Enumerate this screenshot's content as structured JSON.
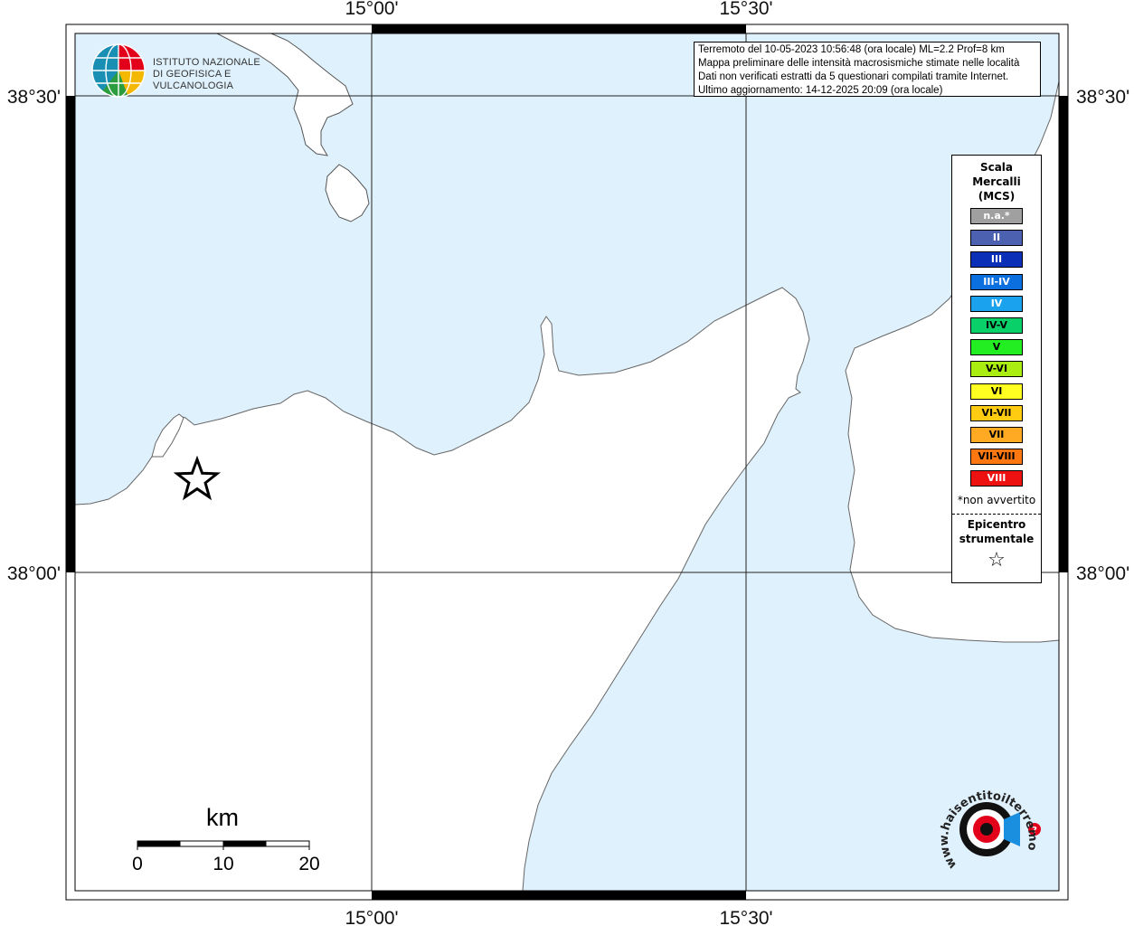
{
  "map": {
    "lon_labels": [
      "15°00'",
      "15°30'"
    ],
    "lat_labels": [
      "38°30'",
      "38°00'"
    ],
    "colors": {
      "sea": "#dff1fc",
      "land": "#ffffff",
      "coast": "#555555",
      "grid": "#222222"
    }
  },
  "info": {
    "line1": "Terremoto del 10-05-2023 10:56:48 (ora locale) ML=2.2 Prof=8 km",
    "line2": "Mappa preliminare delle intensità macrosismiche stimate nelle località",
    "line3": "Dati non verificati estratti da 5 questionari compilati tramite Internet.",
    "line4": "Ultimo aggiornamento: 14-12-2025 20:09 (ora locale)"
  },
  "logo": {
    "line1": "ISTITUTO NAZIONALE",
    "line2": "DI GEOFISICA E VULCANOLOGIA"
  },
  "legend": {
    "title1": "Scala",
    "title2": "Mercalli",
    "title3": "(MCS)",
    "items": [
      {
        "label": "n.a.*",
        "color": "#a0a0a0",
        "text": "#ffffff"
      },
      {
        "label": "II",
        "color": "#4c62b0",
        "text": "#ffffff"
      },
      {
        "label": "III",
        "color": "#0c2fb8",
        "text": "#ffffff"
      },
      {
        "label": "III-IV",
        "color": "#0b6fe0",
        "text": "#ffffff"
      },
      {
        "label": "IV",
        "color": "#1aa2ee",
        "text": "#ffffff"
      },
      {
        "label": "IV-V",
        "color": "#0ad06a",
        "text": "#000000"
      },
      {
        "label": "V",
        "color": "#22ee22",
        "text": "#000000"
      },
      {
        "label": "V-VI",
        "color": "#aaee11",
        "text": "#000000"
      },
      {
        "label": "VI",
        "color": "#ffff22",
        "text": "#000000"
      },
      {
        "label": "VI-VII",
        "color": "#ffcc11",
        "text": "#000000"
      },
      {
        "label": "VII",
        "color": "#ffaa22",
        "text": "#000000"
      },
      {
        "label": "VII-VIII",
        "color": "#ff7711",
        "text": "#000000"
      },
      {
        "label": "VIII",
        "color": "#ee1111",
        "text": "#ffffff"
      }
    ],
    "note": "*non avvertito",
    "epicenter1": "Epicentro",
    "epicenter2": "strumentale",
    "epicenter_symbol": "☆"
  },
  "scale_bar": {
    "unit": "km",
    "labels": [
      "0",
      "10",
      "20"
    ]
  },
  "site_logo": {
    "text": "www.haisentitoilterremoto.it",
    "question": "?"
  }
}
